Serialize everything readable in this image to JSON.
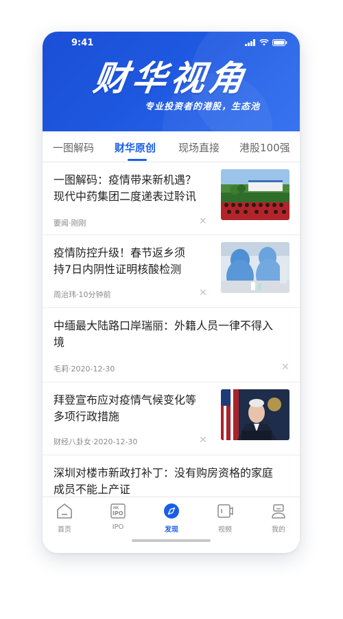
{
  "status_bar": {
    "time": "9:41"
  },
  "header": {
    "brand": "财华视角",
    "slogan": "专业投资者的港股，生态池",
    "brand_color": "#1f58e0"
  },
  "tabs": [
    {
      "label": "一图解码",
      "active": false
    },
    {
      "label": "财华原创",
      "active": true
    },
    {
      "label": "现场直接",
      "active": false
    },
    {
      "label": "港股100强",
      "active": false
    }
  ],
  "articles": [
    {
      "title_line1": "一图解码：疫情带来新机遇？",
      "title_line2": "现代中药集团二度递表过聆讯",
      "meta": "要闻·刚刚",
      "thumbnail": "outdoor-group-photo"
    },
    {
      "title_line1": "疫情防控升级！春节返乡须",
      "title_line2": "持7日内阴性证明核酸检测",
      "meta": "周治玮·10分钟前",
      "thumbnail": "lab-workers-protective-suits"
    },
    {
      "title_line1": "中缅最大陆路口岸瑞丽：外籍人员一律不得入",
      "title_line2": "境",
      "meta": "毛莉·2020-12-30",
      "thumbnail": ""
    },
    {
      "title_line1": "拜登宣布应对疫情气候变化等",
      "title_line2": "多项行政措施",
      "meta": "财经八卦女·2020-12-30",
      "thumbnail": "press-conference-speaker"
    },
    {
      "title_line1": "深圳对楼市新政打补丁：没有购房资格的家庭",
      "title_line2": "成员不能上产证",
      "meta": "",
      "thumbnail": ""
    }
  ],
  "close_glyph": "✕",
  "bottom_nav": [
    {
      "label": "首页",
      "icon": "home-icon",
      "active": false
    },
    {
      "label": "IPO",
      "icon": "ipo-icon",
      "active": false
    },
    {
      "label": "发现",
      "icon": "compass-icon",
      "active": true
    },
    {
      "label": "视频",
      "icon": "video-icon",
      "active": false
    },
    {
      "label": "我的",
      "icon": "profile-icon",
      "active": false
    }
  ],
  "ipo_badge_top": "HK",
  "ipo_badge_main": "IPO",
  "accent_color": "#1a5ee6"
}
